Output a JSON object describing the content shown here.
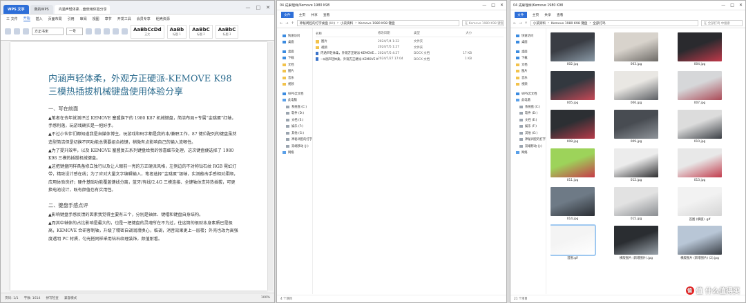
{
  "word": {
    "tabs": [
      "WPS 文字",
      "我的WPS",
      "内涵声轻体柔…盘使用体验分享"
    ],
    "win_controls": [
      "—",
      "□",
      "✕"
    ],
    "menu": [
      "三 文件",
      "开始",
      "插入",
      "页面布局",
      "引用",
      "审阅",
      "视图",
      "章节",
      "开发工具",
      "会员专享",
      "稻壳资源"
    ],
    "font_name": "方正书宋",
    "font_size": "一号",
    "styles": [
      {
        "sample": "AaBbCcDd",
        "name": "正文"
      },
      {
        "sample": "AaBb",
        "name": "标题 1"
      },
      {
        "sample": "AaBbC",
        "name": "标题 2"
      },
      {
        "sample": "AaBbC",
        "name": "标题 3"
      }
    ],
    "doc": {
      "title": "内涵声轻体柔，外观方正硬派-KEMOVE K98 三模热插拔机械键盘使用体验分享",
      "h1": "一、写在前面",
      "p1": "▲笔者在去年就测评过 KEMOVE 塞盟旗下的 1980 K87 机械键盘，简洁布局+专属“金跳蛋”红轴，手感利落，玩游戏确实是一把好手。",
      "p2": "▲不过小伙伴们都知道我是自媒体博主，玩游戏和码字都是我的本/兼职工作，87 键位配列的键盘虽然造型简洁但是切换不同功能总需要组合按键，稍微有点影响自己的输入流畅性。",
      "p3": "▲为了提升效率，以及 KEMOVE 塞盟复古系列键盘给我的惊喜细节处理，这次键盘便选择了 1980 K98 三模热插拔机械键盘。",
      "p4": "▲这把键盘同样具备修立独行以及让人眼前一亮的方正硬派风格，左侧边的不对称钻石纹 RGB 霓虹灯带，精致设计感在线；为了应对大量文字编辑输入，笔者选择“金跳蛋”银轴，实测敲击手感相对柔顺，应用体验良好；硬件基础功能覆盖键线分离，蓝牙/有线/2.4G 三模连接、全键轴体支持热插拔，可更换电池设计，既有颜值也有实用性。",
      "h2": "二、键盘手感点评",
      "p5": "▲影响键盘手感反馈的因素我觉得主要有三个，分别是轴体、键帽和键盘自身结构。",
      "p6": "▲而其中轴体的占比影响是最大的，也是一把键盘的灵魂所在不为过，往这筒的很财本身素质已是极高，KEMOVE 合研客制轴，升级了精密自调润滑换心，临调，消音效果更上一层楼；外壳也改为高强度透明 PC 材质，匀光搭同样采用钻石纹理装饰，颜值耐看。"
    },
    "status": {
      "page": "页码: 1/1",
      "words": "字数: 1614",
      "spell": "拼写检查",
      "mode": "兼容模式",
      "zoom": "100%"
    }
  },
  "explorer1": {
    "title": "04 成果理样/Kemove 1980 K98",
    "tabs": [
      "文件",
      "主页",
      "共享",
      "查看"
    ],
    "path": [
      "神秘闭腔的打字桌盘 (H:)",
      "小菜资料",
      "Kemove 1980 K98 键盘"
    ],
    "search_placeholder": "在 Kemove 1980 K98 键盘中搜索",
    "sidebar": [
      {
        "label": "快速访问",
        "icon": "star-icon",
        "type": "blue"
      },
      {
        "label": "桌面",
        "icon": "desktop-icon",
        "type": "blue"
      },
      {
        "label": "",
        "icon": "",
        "type": "gap"
      },
      {
        "label": "桌面",
        "icon": "desktop-icon",
        "type": "blue"
      },
      {
        "label": "下载",
        "icon": "download-icon",
        "type": "blue"
      },
      {
        "label": "文档",
        "icon": "document-icon",
        "type": "folder"
      },
      {
        "label": "图片",
        "icon": "picture-icon",
        "type": "folder"
      },
      {
        "label": "音乐",
        "icon": "music-icon",
        "type": "folder"
      },
      {
        "label": "视频",
        "icon": "video-icon",
        "type": "folder"
      },
      {
        "label": "",
        "icon": "",
        "type": "gap"
      },
      {
        "label": "WPS云文档",
        "icon": "cloud-icon",
        "type": "blue"
      },
      {
        "label": "此电脑",
        "icon": "pc-icon",
        "type": "pc"
      },
      {
        "label": "系统盘 (C:)",
        "icon": "disk-icon",
        "type": "disk"
      },
      {
        "label": "软件 (D:)",
        "icon": "disk-icon",
        "type": "disk"
      },
      {
        "label": "文档 (E:)",
        "icon": "disk-icon",
        "type": "disk"
      },
      {
        "label": "娱乐 (F:)",
        "icon": "disk-icon",
        "type": "disk"
      },
      {
        "label": "其他 (G:)",
        "icon": "disk-icon",
        "type": "disk"
      },
      {
        "label": "神秘闭腔的打字桌",
        "icon": "disk-icon",
        "type": "disk"
      },
      {
        "label": "双端移动 (J:)",
        "icon": "disk-icon",
        "type": "disk"
      },
      {
        "label": "网络",
        "icon": "network-icon",
        "type": "pc"
      }
    ],
    "columns": [
      "名称",
      "修改日期",
      "类型",
      "大小"
    ],
    "files": [
      {
        "name": "图片",
        "date": "2024/7/4 1:22",
        "type": "文件夹",
        "size": "",
        "icon": "folder"
      },
      {
        "name": "视频",
        "date": "2024/7/5 1:27",
        "type": "文件夹",
        "size": "",
        "icon": "folder"
      },
      {
        "name": "内涵声轻体柔，外观方正硬派-KEMOVE…",
        "date": "2024/7/5 4:27",
        "type": "DOCX 文档",
        "size": "17 KB",
        "icon": "doc"
      },
      {
        "name": "~$涵声轻体柔，外观方正硬派-KEMOVE K…",
        "date": "2024/7/27 17:04",
        "type": "DOCX 文档",
        "size": "1 KB",
        "icon": "doc"
      }
    ],
    "status": "4 个项目"
  },
  "explorer2": {
    "title": "04 成果理样/Kemove 1980 K98",
    "tabs": [
      "文件",
      "主页",
      "共享",
      "查看"
    ],
    "path": [
      "小菜资料",
      "Kemove 1980 K98 键盘",
      "全部打鸡"
    ],
    "search_placeholder": "在 全部打鸡 中搜索",
    "sidebar": [
      {
        "label": "快速访问",
        "icon": "star-icon",
        "type": "blue"
      },
      {
        "label": "桌面",
        "icon": "desktop-icon",
        "type": "blue"
      },
      {
        "label": "",
        "icon": "",
        "type": "gap"
      },
      {
        "label": "桌面",
        "icon": "desktop-icon",
        "type": "blue"
      },
      {
        "label": "下载",
        "icon": "download-icon",
        "type": "blue"
      },
      {
        "label": "文档",
        "icon": "document-icon",
        "type": "folder"
      },
      {
        "label": "图片",
        "icon": "picture-icon",
        "type": "folder"
      },
      {
        "label": "音乐",
        "icon": "music-icon",
        "type": "folder"
      },
      {
        "label": "视频",
        "icon": "video-icon",
        "type": "folder"
      },
      {
        "label": "",
        "icon": "",
        "type": "gap"
      },
      {
        "label": "WPS云文档",
        "icon": "cloud-icon",
        "type": "blue"
      },
      {
        "label": "此电脑",
        "icon": "pc-icon",
        "type": "pc"
      },
      {
        "label": "系统盘 (C:)",
        "icon": "disk-icon",
        "type": "disk"
      },
      {
        "label": "软件 (D:)",
        "icon": "disk-icon",
        "type": "disk"
      },
      {
        "label": "文档 (E:)",
        "icon": "disk-icon",
        "type": "disk"
      },
      {
        "label": "娱乐 (F:)",
        "icon": "disk-icon",
        "type": "disk"
      },
      {
        "label": "其他 (G:)",
        "icon": "disk-icon",
        "type": "disk"
      },
      {
        "label": "神秘闭腔的打字桌",
        "icon": "disk-icon",
        "type": "disk"
      },
      {
        "label": "双端移动 (J:)",
        "icon": "disk-icon",
        "type": "disk"
      },
      {
        "label": "网络",
        "icon": "network-icon",
        "type": "pc"
      }
    ],
    "thumbnails": [
      {
        "caption": "002.jpg",
        "colors": [
          "#3a3d44",
          "#8a9aa7"
        ]
      },
      {
        "caption": "003.jpg",
        "colors": [
          "#d8d3cc",
          "#6d6a66"
        ]
      },
      {
        "caption": "004.jpg",
        "colors": [
          "#2a2a2e",
          "#c0394a"
        ]
      },
      {
        "caption": "005.jpg",
        "colors": [
          "#33383f",
          "#c74856"
        ]
      },
      {
        "caption": "006.jpg",
        "colors": [
          "#e9e7e3",
          "#5b5e63"
        ]
      },
      {
        "caption": "007.jpg",
        "colors": [
          "#d6d7d9",
          "#ab4a57"
        ]
      },
      {
        "caption": "008.jpg",
        "colors": [
          "#2c2f33",
          "#b73a49"
        ]
      },
      {
        "caption": "009.jpg",
        "colors": [
          "#484c52",
          "#8f949a"
        ]
      },
      {
        "caption": "010.jpg",
        "colors": [
          "#dcdcdc",
          "#3b3f45"
        ]
      },
      {
        "caption": "011.jpg",
        "colors": [
          "#9dd35a",
          "#c73a48"
        ]
      },
      {
        "caption": "012.jpg",
        "colors": [
          "#ececec",
          "#2e2e30"
        ]
      },
      {
        "caption": "013.jpg",
        "colors": [
          "#e8e8e8",
          "#c23c4d"
        ]
      },
      {
        "caption": "014.jpg",
        "colors": [
          "#6e7a86",
          "#2a2e33"
        ]
      },
      {
        "caption": "015.jpg",
        "colors": [
          "#e2e2e2",
          "#8a8d91"
        ]
      },
      {
        "caption": "首图 (横版) .gif",
        "colors": [
          "#f2f2f2",
          "#d5d5d5"
        ]
      },
      {
        "caption": "首图.gif",
        "colors": [
          "#f4f4f4",
          "#ffffff"
        ]
      },
      {
        "caption": "横版图片 (新增图片).jpg",
        "colors": [
          "#2a2d31",
          "#9aa3ab"
        ]
      },
      {
        "caption": "横版图片 (新增图片) (2).jpg",
        "colors": [
          "#b8c6d6",
          "#3a3f46"
        ]
      }
    ],
    "status": "21 个项目",
    "watermark": "值 什么值得买"
  }
}
